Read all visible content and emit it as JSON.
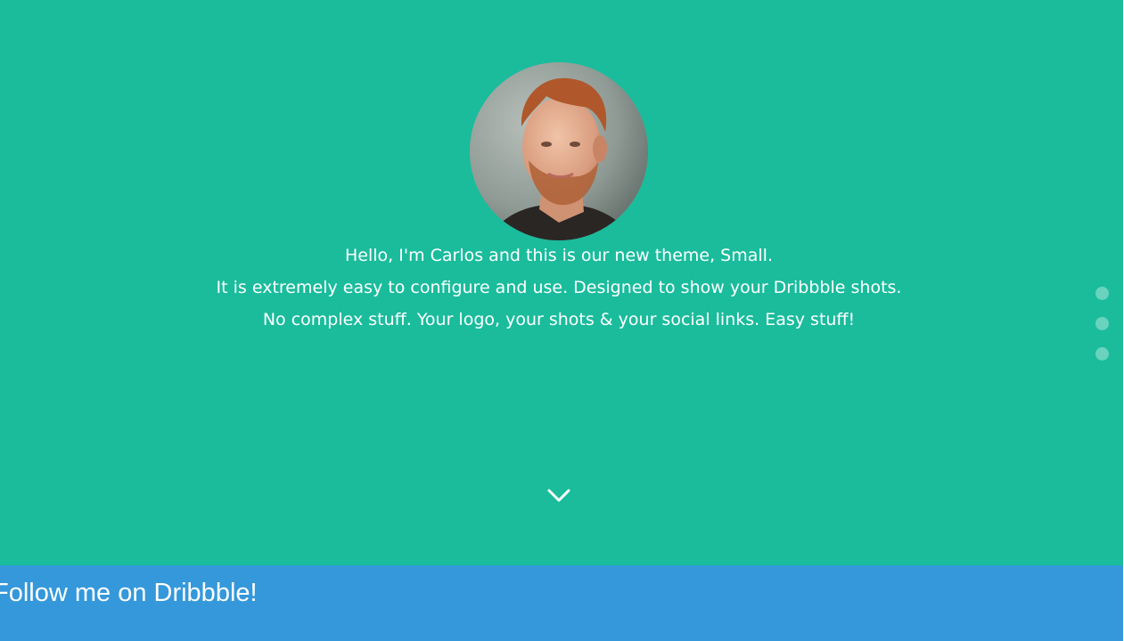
{
  "colors": {
    "hero_background": "#1abc9c",
    "footer_background": "#3498db",
    "text": "#ffffff"
  },
  "hero": {
    "avatar_alt": "Carlos",
    "intro_lines": [
      "Hello, I'm Carlos and this is our new theme, Small.",
      "It is extremely easy to configure and use. Designed to show your Dribbble shots.",
      "No complex stuff. Your logo, your shots & your social links. Easy stuff!"
    ],
    "scroll_icon": "chevron-down-icon"
  },
  "section_nav": {
    "count": 3,
    "active_index": 0
  },
  "footer": {
    "title": "Follow me on Dribbble!"
  }
}
